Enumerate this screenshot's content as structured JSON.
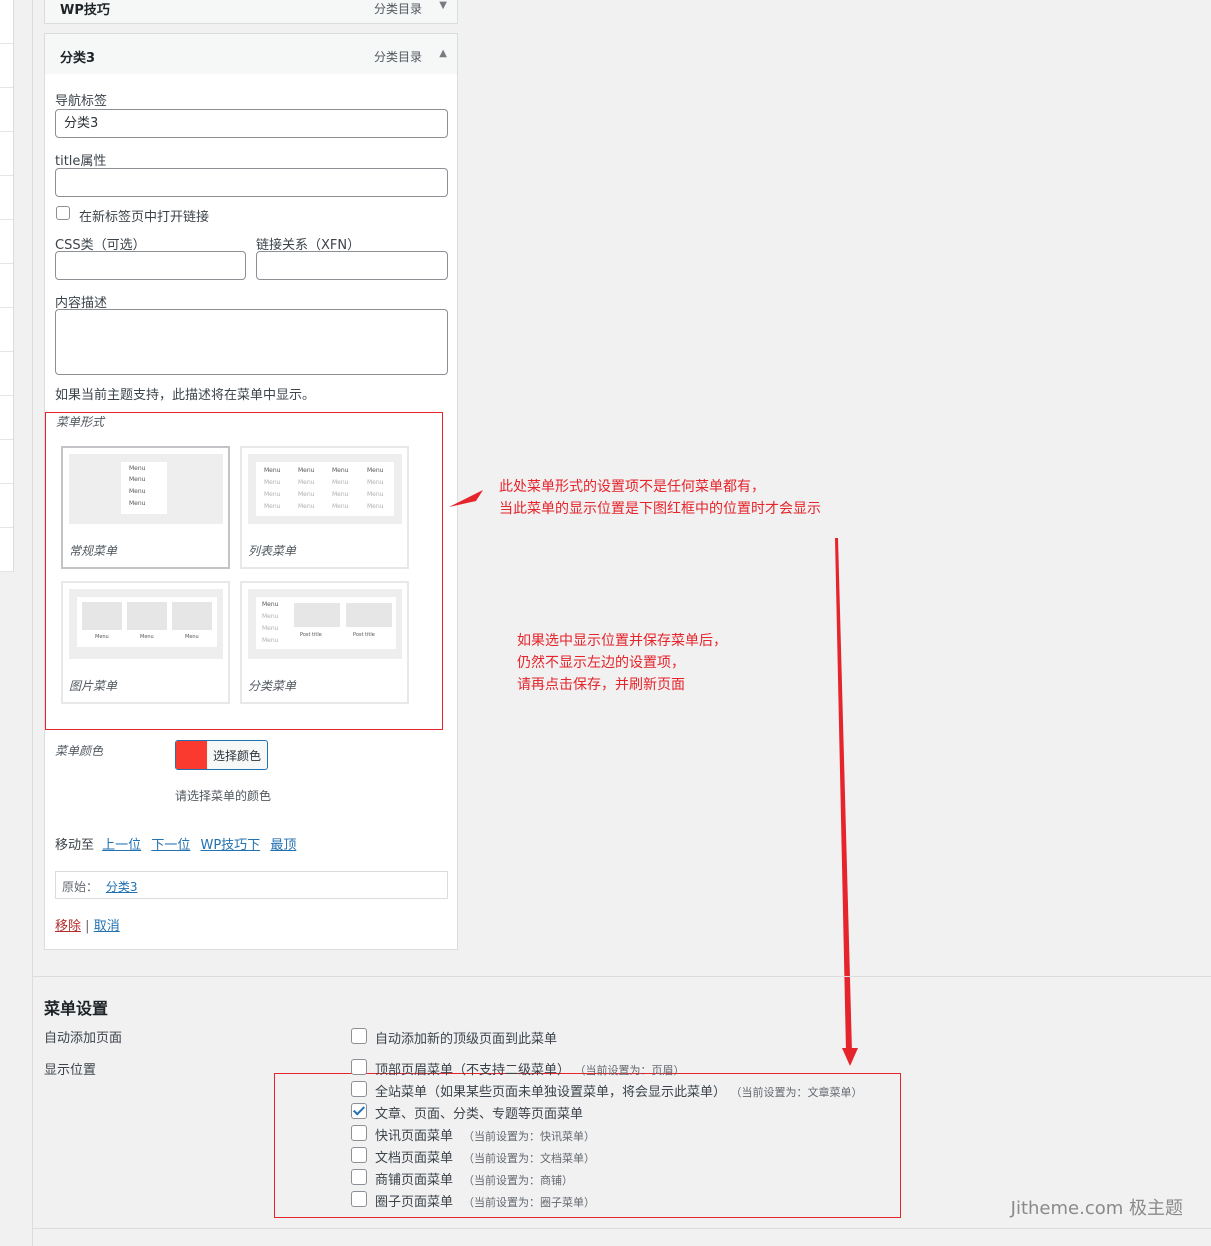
{
  "items": {
    "prev": {
      "title": "WP技巧",
      "type": "分类目录"
    },
    "current": {
      "title": "分类3",
      "type": "分类目录"
    }
  },
  "form": {
    "nav_label": "导航标签",
    "nav_value": "分类3",
    "title_attr_label": "title属性",
    "title_attr_value": "",
    "new_tab_label": "在新标签页中打开链接",
    "css_label": "CSS类（可选）",
    "xfn_label": "链接关系（XFN）",
    "desc_label": "内容描述",
    "desc_hint": "如果当前主题支持，此描述将在菜单中显示。"
  },
  "menu_style": {
    "label": "菜单形式",
    "options": [
      {
        "label": "常规菜单",
        "selected": true
      },
      {
        "label": "列表菜单",
        "selected": false
      },
      {
        "label": "图片菜单",
        "selected": false
      },
      {
        "label": "分类菜单",
        "selected": false
      }
    ],
    "preview_word": "Menu",
    "preview_post": "Post title"
  },
  "menu_color": {
    "label": "菜单颜色",
    "swatch": "#fa3a2f",
    "button": "选择颜色",
    "hint": "请选择菜单的颜色"
  },
  "move": {
    "label": "移动至",
    "links": [
      "上一位",
      "下一位",
      "WP技巧下",
      "最顶"
    ]
  },
  "original": {
    "label": "原始：",
    "link": "分类3"
  },
  "actions": {
    "remove": "移除",
    "separator": "|",
    "cancel": "取消"
  },
  "notes": {
    "note1": [
      "此处菜单形式的设置项不是任何菜单都有，",
      "当此菜单的显示位置是下图红框中的位置时才会显示"
    ],
    "note2": [
      "如果选中显示位置并保存菜单后，",
      "仍然不显示左边的设置项，",
      "请再点击保存，并刷新页面"
    ]
  },
  "settings": {
    "heading": "菜单设置",
    "auto_add_label": "自动添加页面",
    "auto_add_option": "自动添加新的顶级页面到此菜单",
    "display_label": "显示位置",
    "locations": [
      {
        "label": "顶部页眉菜单（不支持二级菜单）",
        "current": "（当前设置为：页眉）",
        "checked": false
      },
      {
        "label": "全站菜单（如果某些页面未单独设置菜单，将会显示此菜单）",
        "current": "（当前设置为：文章菜单）",
        "checked": false
      },
      {
        "label": "文章、页面、分类、专题等页面菜单",
        "current": "",
        "checked": true
      },
      {
        "label": "快讯页面菜单",
        "current": "（当前设置为：快讯菜单）",
        "checked": false
      },
      {
        "label": "文档页面菜单",
        "current": "（当前设置为：文档菜单）",
        "checked": false
      },
      {
        "label": "商铺页面菜单",
        "current": "（当前设置为：商铺）",
        "checked": false
      },
      {
        "label": "圈子页面菜单",
        "current": "（当前设置为：圈子菜单）",
        "checked": false
      }
    ]
  },
  "watermark": "Jitheme.com 极主题",
  "colors": {
    "annotation": "#e5242b",
    "link": "#2271b1"
  }
}
